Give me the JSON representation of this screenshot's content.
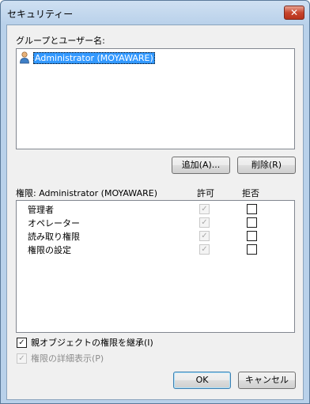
{
  "window": {
    "title": "セキュリティー",
    "close_glyph": "✕"
  },
  "users_section": {
    "label": "グループとユーザー名:",
    "items": [
      {
        "name": "Administrator (MOYAWARE)",
        "icon": "user-icon",
        "selected": true
      }
    ]
  },
  "buttons": {
    "add": "追加(A)...",
    "remove": "削除(R)",
    "ok": "OK",
    "cancel": "キャンセル"
  },
  "permissions": {
    "header": "権限: Administrator (MOYAWARE)",
    "allow_header": "許可",
    "deny_header": "拒否",
    "rows": [
      {
        "name": "管理者",
        "allow": true,
        "deny": false
      },
      {
        "name": "オペレーター",
        "allow": true,
        "deny": false
      },
      {
        "name": "読み取り権限",
        "allow": true,
        "deny": false
      },
      {
        "name": "権限の設定",
        "allow": true,
        "deny": false
      }
    ]
  },
  "options": {
    "inherit": {
      "label": "親オブジェクトの権限を継承(I)",
      "checked": true,
      "enabled": true
    },
    "advanced": {
      "label": "権限の詳細表示(P)",
      "checked": true,
      "enabled": false
    }
  },
  "colors": {
    "selection": "#3399ff",
    "frame": "#b9d1ea",
    "close_button": "#c7462e"
  }
}
